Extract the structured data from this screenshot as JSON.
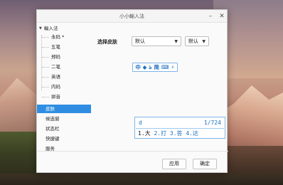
{
  "window": {
    "title": "小小輸入法"
  },
  "sidebar": {
    "items": [
      {
        "label": "輸入法",
        "level": 0,
        "expanded": true,
        "selected": false
      },
      {
        "label": "永码 *",
        "level": 1,
        "selected": false
      },
      {
        "label": "五笔",
        "level": 1,
        "selected": false
      },
      {
        "label": "郑码",
        "level": 1,
        "selected": false
      },
      {
        "label": "二笔",
        "level": 1,
        "selected": false
      },
      {
        "label": "英语",
        "level": 1,
        "selected": false
      },
      {
        "label": "内码",
        "level": 1,
        "selected": false
      },
      {
        "label": "拼音",
        "level": 1,
        "selected": false
      },
      {
        "label": "皮肤",
        "level": 0,
        "selected": true
      },
      {
        "label": "候选窗",
        "level": 0,
        "selected": false
      },
      {
        "label": "状态栏",
        "level": 0,
        "selected": false
      },
      {
        "label": "快捷键",
        "level": 0,
        "selected": false
      },
      {
        "label": "服务",
        "level": 0,
        "selected": false
      }
    ]
  },
  "skin": {
    "label": "选择皮肤",
    "selected_skin": "默认",
    "selected_variant": "默认"
  },
  "status_bar": {
    "items": [
      "中",
      "◆",
      "ঌ",
      "简",
      "⌨",
      "⚡"
    ],
    "icon_names": [
      "chinese-mode-icon",
      "punctuation-icon",
      "moon-icon",
      "simplified-icon",
      "keyboard-icon",
      "lightning-icon"
    ]
  },
  "candidate": {
    "code": "d",
    "page": "1/724",
    "first": "1.大",
    "rest": " 2.打 3.答 4.达"
  },
  "buttons": {
    "apply": "应用",
    "ok": "确定"
  }
}
